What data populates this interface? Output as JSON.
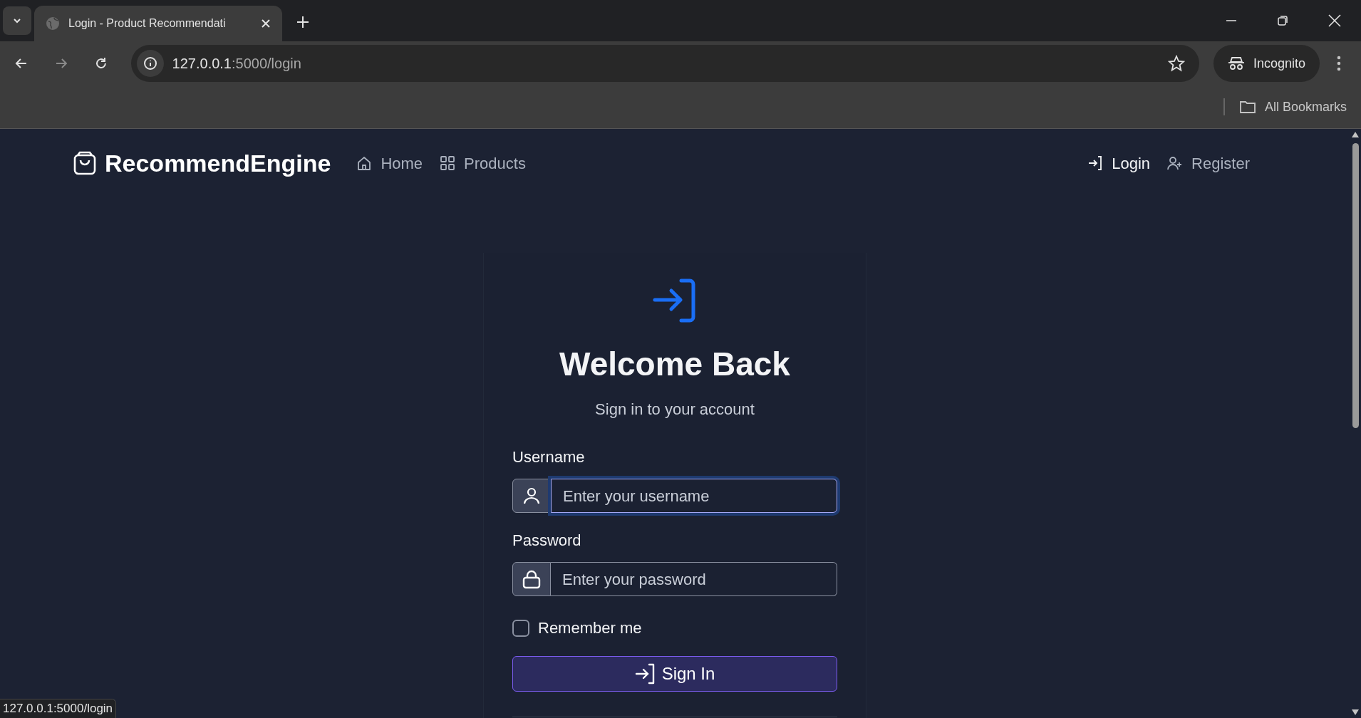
{
  "browser": {
    "tab_title": "Login - Product Recommendati",
    "address_host": "127.0.0.1",
    "address_path": ":5000/login",
    "profile": "Incognito",
    "bookmarks": "All Bookmarks"
  },
  "navbar": {
    "brand": "RecommendEngine",
    "left_links": [
      {
        "label": "Home",
        "selected": false
      },
      {
        "label": "Products",
        "selected": false
      }
    ],
    "right_links": [
      {
        "label": "Login",
        "selected": true
      },
      {
        "label": "Register",
        "selected": false
      }
    ]
  },
  "login_card": {
    "title": "Welcome Back",
    "subtitle": "Sign in to your account",
    "fields": [
      {
        "label": "Username",
        "placeholder": "Enter your username",
        "focused": true
      },
      {
        "label": "Password",
        "placeholder": "Enter your password",
        "focused": false
      }
    ],
    "remember": {
      "label": "Remember me",
      "checked": false
    },
    "submit": "Sign In"
  },
  "status_bubble": "127.0.0.1:5000/login"
}
